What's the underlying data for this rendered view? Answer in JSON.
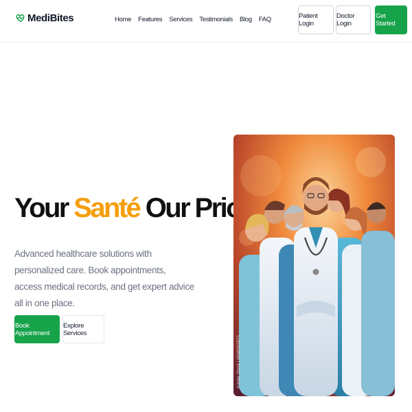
{
  "brand": {
    "name": "MediBites",
    "icon": "heart-pulse-icon",
    "color": "#16a34a"
  },
  "nav": {
    "links": [
      "Home",
      "Features",
      "Services",
      "Testimonials",
      "Blog",
      "FAQ"
    ],
    "patient_login": "Patient Login",
    "doctor_login": "Doctor Login",
    "get_started": "Get Started"
  },
  "hero": {
    "title_part1": "Your ",
    "title_accent": "Santé",
    "title_part2": " Our Priority",
    "description": "Advanced healthcare solutions with personalized care. Book appointments, access medical records, and get expert advice all in one place.",
    "book_appointment": "Book Appointment",
    "explore_services": "Explore Services",
    "image_watermark": "Adobe Stock | #668463871"
  },
  "colors": {
    "primary": "#16a34a",
    "accent": "#f59e0b",
    "text": "#111827",
    "muted": "#6b7280"
  }
}
